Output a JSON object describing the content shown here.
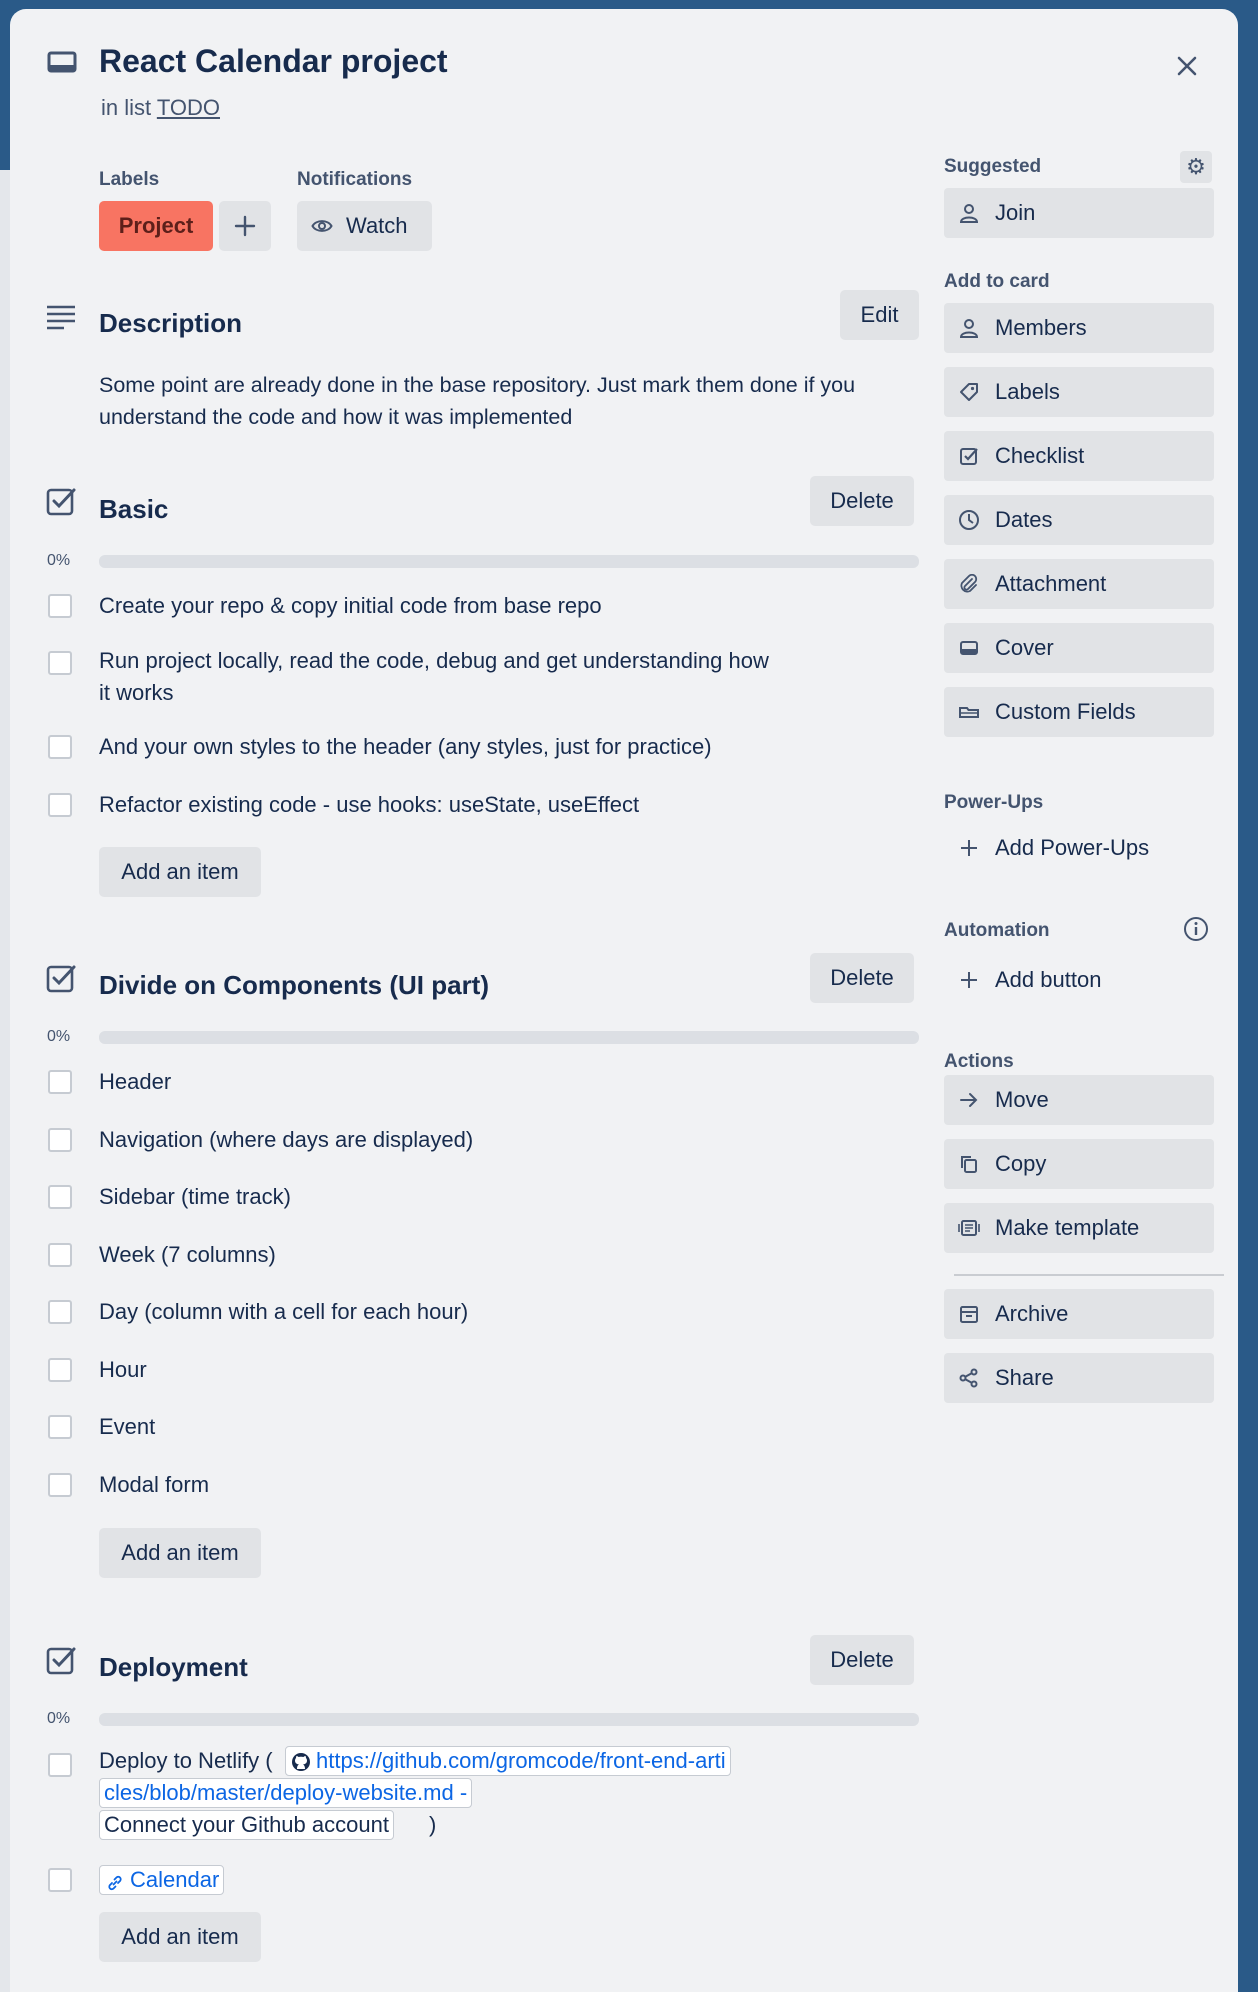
{
  "card": {
    "title": "React Calendar project",
    "in_list_prefix": "in list",
    "list_name": "TODO"
  },
  "labels": {
    "heading": "Labels",
    "items": [
      "Project"
    ],
    "label_color": "#f87462"
  },
  "notifications": {
    "heading": "Notifications",
    "watch_label": "Watch"
  },
  "description": {
    "heading": "Description",
    "edit_label": "Edit",
    "text": "Some point are already done in the base repository. Just mark them done if you understand the code and how it was implemented"
  },
  "checklists": [
    {
      "title": "Basic",
      "delete_label": "Delete",
      "progress": "0%",
      "progress_value": 0,
      "items": [
        "Create your repo & copy initial code from base repo",
        "Run project locally, read the code, debug and get understanding how it works",
        "And your own styles to the header (any styles, just for practice)",
        "Refactor existing code - use hooks: useState, useEffect"
      ],
      "add_label": "Add an item"
    },
    {
      "title": "Divide on Components (UI part)",
      "delete_label": "Delete",
      "progress": "0%",
      "progress_value": 0,
      "items": [
        "Header",
        "Navigation (where days are displayed)",
        "Sidebar (time track)",
        "Week (7 columns)",
        "Day (column with a cell for each hour)",
        "Hour",
        "Event",
        "Modal form"
      ],
      "add_label": "Add an item"
    },
    {
      "title": "Deployment",
      "delete_label": "Delete",
      "progress": "0%",
      "progress_value": 0,
      "items": [
        {
          "prefix": "Deploy to Netlify (",
          "link_line1": "https://github.com/gromcode/front-end-arti",
          "link_line2": "cles/blob/master/deploy-website.md -",
          "link_line3": "Connect your Github account",
          "suffix": ")"
        },
        {
          "link": "Calendar"
        }
      ],
      "add_label": "Add an item"
    }
  ],
  "sidebar": {
    "suggested_heading": "Suggested",
    "join_label": "Join",
    "add_to_card_heading": "Add to card",
    "add_to_card": [
      {
        "label": "Members",
        "icon": "person-icon"
      },
      {
        "label": "Labels",
        "icon": "tag-icon"
      },
      {
        "label": "Checklist",
        "icon": "checklist-icon"
      },
      {
        "label": "Dates",
        "icon": "clock-icon"
      },
      {
        "label": "Attachment",
        "icon": "paperclip-icon"
      },
      {
        "label": "Cover",
        "icon": "cover-icon"
      },
      {
        "label": "Custom Fields",
        "icon": "custom-fields-icon"
      }
    ],
    "powerups_heading": "Power-Ups",
    "add_powerups_label": "Add Power-Ups",
    "automation_heading": "Automation",
    "add_button_label": "Add button",
    "actions_heading": "Actions",
    "actions": [
      {
        "label": "Move",
        "icon": "arrow-right-icon"
      },
      {
        "label": "Copy",
        "icon": "copy-icon"
      },
      {
        "label": "Make template",
        "icon": "template-icon"
      },
      {
        "label": "Archive",
        "icon": "archive-icon"
      },
      {
        "label": "Share",
        "icon": "share-icon"
      }
    ]
  }
}
